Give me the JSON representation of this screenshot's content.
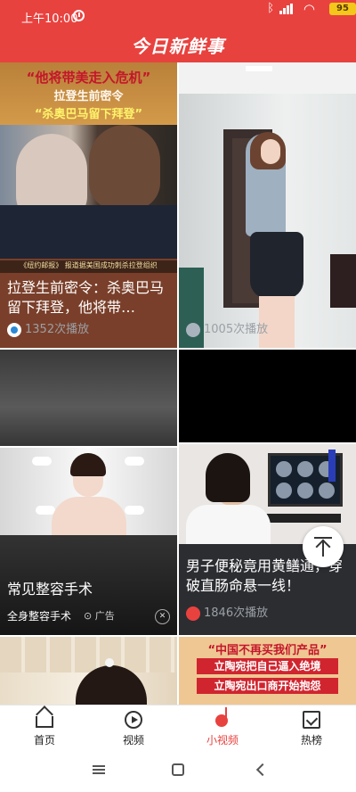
{
  "status_bar": {
    "time": "上午10:00",
    "battery": "95"
  },
  "header": {
    "title": "今日新鲜事"
  },
  "feed": {
    "card1": {
      "headline_1": "“他将带美走入危机”",
      "headline_2": "拉登生前密令",
      "headline_3": "“杀奥巴马留下拜登”",
      "caption_strip": "《纽约邮报》 报道据美国成功刺杀拉登组织",
      "title": "拉登生前密令：杀奥巴马留下拜登，他将带…",
      "plays": "1352次播放"
    },
    "card2": {
      "plays": "1005次播放"
    },
    "card5": {
      "title": "常见整容手术",
      "sponsor": "全身整容手术",
      "ad_tag": "广告",
      "close": "✕"
    },
    "card6": {
      "title": "男子便秘竟用黄鳝通，穿破直肠命悬一线！",
      "plays": "1846次播放"
    },
    "card8": {
      "headline_1": "“中国不再买我们产品”",
      "headline_2": "立陶宛把自己逼入绝境",
      "headline_3": "立陶宛出口商开始抱怨"
    }
  },
  "bottom_nav": {
    "items": [
      {
        "label": "首页",
        "icon": "home-icon"
      },
      {
        "label": "视频",
        "icon": "video-play-icon"
      },
      {
        "label": "小视频",
        "icon": "short-video-icon",
        "active": true
      },
      {
        "label": "热榜",
        "icon": "hot-list-icon"
      }
    ]
  },
  "colors": {
    "brand_red": "#e8423f",
    "battery_yellow": "#f4c81a"
  }
}
